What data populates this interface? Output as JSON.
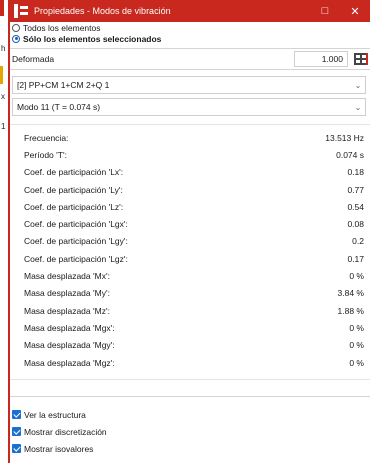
{
  "window": {
    "title": "Propiedades - Modos de vibración",
    "minimize_label": "□",
    "close_label": "✕"
  },
  "background_app": {
    "chars": [
      "h",
      "x",
      "1"
    ]
  },
  "selection": {
    "all_elements_label": "Todos los elementos",
    "selected_elements_label": "Sólo los elementos seleccionados",
    "selected": "selected_elements"
  },
  "deformada": {
    "label": "Deformada",
    "value": "1.000",
    "icon": "grid-icon"
  },
  "combination_select": {
    "value": "[2] PP+CM 1+CM 2+Q 1",
    "icon": "chevron-down-icon"
  },
  "mode_select": {
    "value": "Modo 11 (T = 0.074 s)",
    "icon": "chevron-down-icon"
  },
  "properties": [
    {
      "label": "Frecuencia:",
      "value": "13.513  Hz"
    },
    {
      "label": "Período 'T':",
      "value": "0.074 s"
    },
    {
      "label": "Coef. de participación 'Lx':",
      "value": "0.18"
    },
    {
      "label": "Coef. de participación 'Ly':",
      "value": "0.77"
    },
    {
      "label": "Coef. de participación 'Lz':",
      "value": "0.54"
    },
    {
      "label": "Coef. de participación 'Lgx':",
      "value": "0.08"
    },
    {
      "label": "Coef. de participación 'Lgy':",
      "value": "0.2"
    },
    {
      "label": "Coef. de participación 'Lgz':",
      "value": "0.17"
    },
    {
      "label": "Masa desplazada 'Mx':",
      "value": "0 %"
    },
    {
      "label": "Masa desplazada 'My':",
      "value": "3.84 %"
    },
    {
      "label": "Masa desplazada 'Mz':",
      "value": "1.88 %"
    },
    {
      "label": "Masa desplazada 'Mgx':",
      "value": "0 %"
    },
    {
      "label": "Masa desplazada 'Mgy':",
      "value": "0 %"
    },
    {
      "label": "Masa desplazada 'Mgz':",
      "value": "0 %"
    }
  ],
  "options": [
    {
      "label": "Ver la estructura",
      "checked": true
    },
    {
      "label": "Mostrar discretización",
      "checked": true
    },
    {
      "label": "Mostrar isovalores",
      "checked": true
    }
  ],
  "colors": {
    "accent": "#c8281e",
    "checkbox": "#1a6fd1"
  }
}
